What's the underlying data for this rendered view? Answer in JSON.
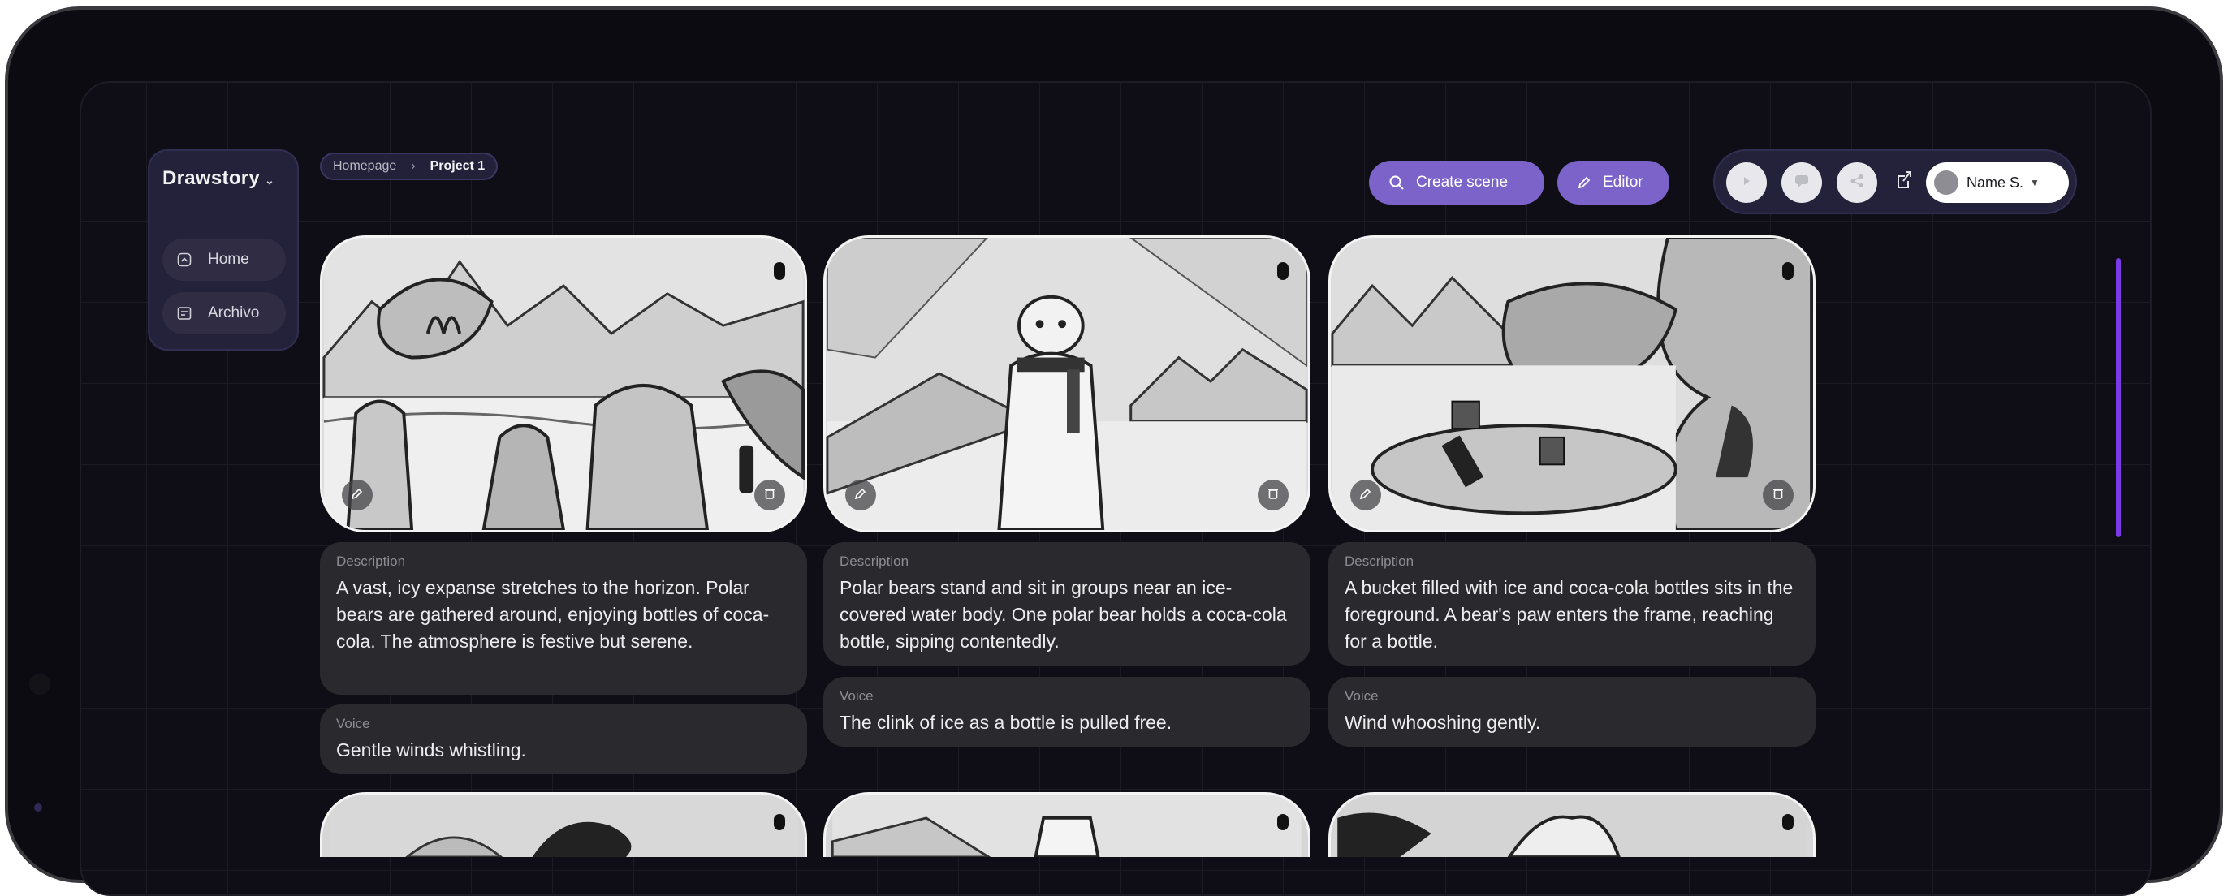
{
  "app": {
    "name": "Drawstory"
  },
  "sidebar": {
    "items": [
      {
        "label": "Home",
        "icon": "home-icon"
      },
      {
        "label": "Archivo",
        "icon": "archive-icon"
      }
    ]
  },
  "breadcrumb": {
    "root": "Homepage",
    "current": "Project 1"
  },
  "actions": {
    "create_scene": "Create scene",
    "editor": "Editor"
  },
  "user": {
    "name": "Name S."
  },
  "colors": {
    "accent": "#7b63c9",
    "scrollbar": "#7a3be6",
    "background": "#0f0e16"
  },
  "scenes": [
    {
      "description_label": "Description",
      "description": "A vast, icy expanse stretches to the horizon. Polar bears are gathered around, enjoying bottles of coca-cola. The atmosphere is festive but serene.",
      "voice_label": "Voice",
      "voice": "Gentle winds whistling."
    },
    {
      "description_label": "Description",
      "description": "Polar bears stand and sit in groups near an ice-covered water body. One polar bear holds a coca-cola bottle, sipping contentedly.",
      "voice_label": "Voice",
      "voice": "The clink of ice as a bottle is pulled free."
    },
    {
      "description_label": "Description",
      "description": "A bucket filled with ice and coca-cola bottles sits in the foreground. A bear's paw enters the frame, reaching for a bottle.",
      "voice_label": "Voice",
      "voice": " Wind whooshing gently."
    }
  ]
}
